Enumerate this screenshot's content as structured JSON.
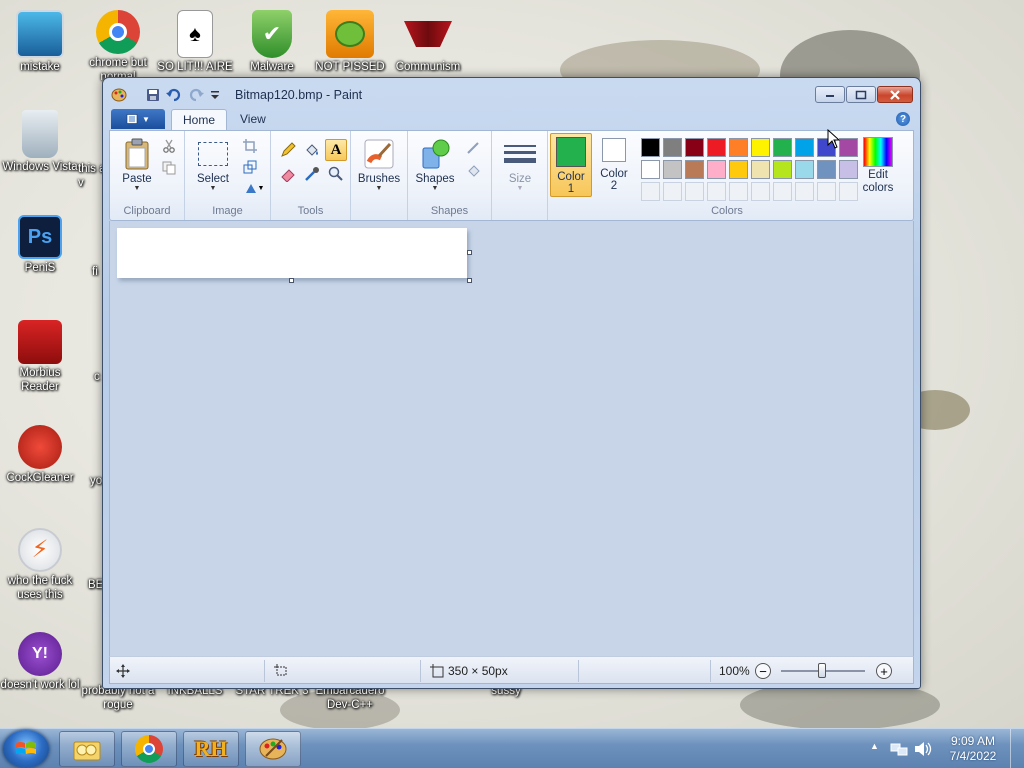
{
  "desktop": {
    "icons": [
      {
        "label": "mistake"
      },
      {
        "label": "chrome but normal"
      },
      {
        "label": "SO LIT!!! AIRE"
      },
      {
        "label": "Malware"
      },
      {
        "label": "NOT PISSED"
      },
      {
        "label": "Communism"
      },
      {
        "label": "Windows Vista"
      },
      {
        "label": "PeniS",
        "glyph": "Ps"
      },
      {
        "label": "Morbius Reader"
      },
      {
        "label": "CockGleaner"
      },
      {
        "label": "who the fuck uses this"
      },
      {
        "label": "doesn't work lol",
        "glyph": "Y!"
      },
      {
        "label": "probably not a rogue"
      },
      {
        "label": "INKBALLS"
      },
      {
        "label": "STAR TREK 3"
      },
      {
        "label": "Embarcadero Dev-C++"
      },
      {
        "label": "sussy"
      }
    ],
    "partial_labels": [
      "this a v",
      "fi",
      "c",
      "yo",
      "BE"
    ]
  },
  "window": {
    "title": "Bitmap120.bmp - Paint",
    "icons": {
      "app": "paint-palette-icon",
      "save": "save-icon",
      "undo": "undo-icon",
      "redo": "redo-icon",
      "customize": "chevron-down-icon"
    }
  },
  "ribbon": {
    "tabs": [
      {
        "label": "Home",
        "active": true
      },
      {
        "label": "View",
        "active": false
      }
    ],
    "help": "?",
    "groups": {
      "clipboard": {
        "label": "Clipboard",
        "paste": "Paste"
      },
      "image": {
        "label": "Image",
        "select": "Select"
      },
      "tools": {
        "label": "Tools",
        "text_tool": "A"
      },
      "brushes": {
        "label": "Brushes"
      },
      "shapes": {
        "label": "Shapes",
        "button": "Shapes"
      },
      "size": {
        "label": "Size"
      },
      "colors": {
        "label": "Colors",
        "color1": {
          "label": "Color",
          "num": "1",
          "value": "#22b14c"
        },
        "color2": {
          "label": "Color",
          "num": "2",
          "value": "#ffffff"
        },
        "edit": {
          "label": "Edit colors"
        },
        "palette_row1": [
          "#000000",
          "#7f7f7f",
          "#880015",
          "#ed1c24",
          "#ff7f27",
          "#fff200",
          "#22b14c",
          "#00a2e8",
          "#3f48cc",
          "#a349a4"
        ],
        "palette_row2": [
          "#ffffff",
          "#c3c3c3",
          "#b97a57",
          "#ffaec9",
          "#ffc90e",
          "#efe4b0",
          "#b5e61d",
          "#99d9ea",
          "#7092be",
          "#c8bfe7"
        ]
      }
    }
  },
  "canvas": {
    "width": 350,
    "height": 50,
    "background": "#ffffff"
  },
  "statusbar": {
    "canvas_size": "350 × 50px",
    "zoom": "100%",
    "zoom_level": 1.0,
    "zoom_out": "−",
    "zoom_in": "+"
  },
  "taskbar": {
    "time": "9:09 AM",
    "date": "7/4/2022",
    "buttons": [
      {
        "name": "explorer",
        "label": ""
      },
      {
        "name": "chrome",
        "label": ""
      },
      {
        "name": "rh",
        "label": "RH"
      },
      {
        "name": "paint",
        "label": ""
      }
    ]
  }
}
